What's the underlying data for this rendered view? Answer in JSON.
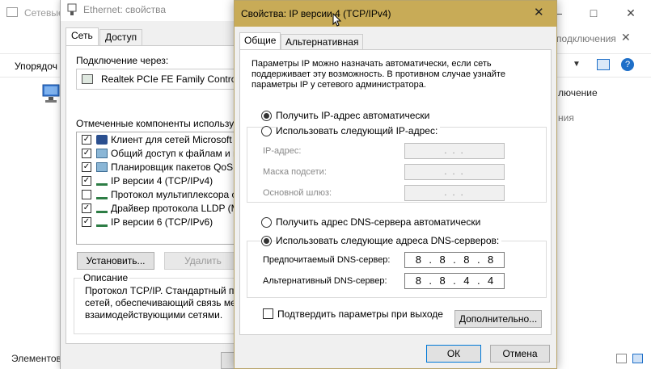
{
  "background_window": {
    "title": "Сетевые",
    "search_text": "подключения",
    "toolbar_organize": "Упорядоч",
    "item_line1": "лючение",
    "item_line2": "ния",
    "status": "Элементов"
  },
  "ethernet_window": {
    "title": "Ethernet: свойства",
    "tabs": [
      "Сеть",
      "Доступ"
    ],
    "connect_via_label": "Подключение через:",
    "adapter": "Realtek PCIe FE Family Controller",
    "components_label": "Отмеченные компоненты используются",
    "components": [
      {
        "label": "Клиент для сетей Microsoft",
        "checked": true,
        "icon": "client-icon"
      },
      {
        "label": "Общий доступ к файлам и при",
        "checked": true,
        "icon": "share-icon"
      },
      {
        "label": "Планировщик пакетов QoS",
        "checked": true,
        "icon": "share-icon"
      },
      {
        "label": "IP версии 4 (TCP/IPv4)",
        "checked": true,
        "icon": "protocol-icon"
      },
      {
        "label": "Протокол мультиплексора сет",
        "checked": false,
        "icon": "protocol-icon"
      },
      {
        "label": "Драйвер протокола LLDP (Ma",
        "checked": true,
        "icon": "protocol-icon"
      },
      {
        "label": "IP версии 6 (TCP/IPv6)",
        "checked": true,
        "icon": "protocol-icon"
      }
    ],
    "install_button": "Установить...",
    "remove_button": "Удалить",
    "description_label": "Описание",
    "description_text": "Протокол TCP/IP. Стандартный прот\nсетей, обеспечивающий связь межд\nвзаимодействующими сетями."
  },
  "ipv4_dialog": {
    "title": "Свойства: IP версии 4 (TCP/IPv4)",
    "tabs": [
      "Общие",
      "Альтернативная конфигурация"
    ],
    "intro": "Параметры IP можно назначать автоматически, если сеть\nподдерживает эту возможность. В противном случае узнайте\nпараметры IP у сетевого администратора.",
    "ip_auto": "Получить IP-адрес автоматически",
    "ip_manual": "Использовать следующий IP-адрес:",
    "ip_auto_selected": true,
    "ip_address_label": "IP-адрес:",
    "subnet_label": "Маска подсети:",
    "gateway_label": "Основной шлюз:",
    "empty_ip": ".   .   .",
    "dns_auto": "Получить адрес DNS-сервера автоматически",
    "dns_manual": "Использовать следующие адреса DNS-серверов:",
    "dns_manual_selected": true,
    "preferred_dns_label": "Предпочитаемый DNS-сервер:",
    "alternate_dns_label": "Альтернативный DNS-сервер:",
    "preferred_dns": [
      "8",
      "8",
      "8",
      "8"
    ],
    "alternate_dns": [
      "8",
      "8",
      "4",
      "4"
    ],
    "validate_label": "Подтвердить параметры при выходе",
    "validate_checked": false,
    "advanced_button": "Дополнительно...",
    "ok_button": "ОК",
    "cancel_button": "Отмена",
    "title_color": "#c8ab57"
  }
}
